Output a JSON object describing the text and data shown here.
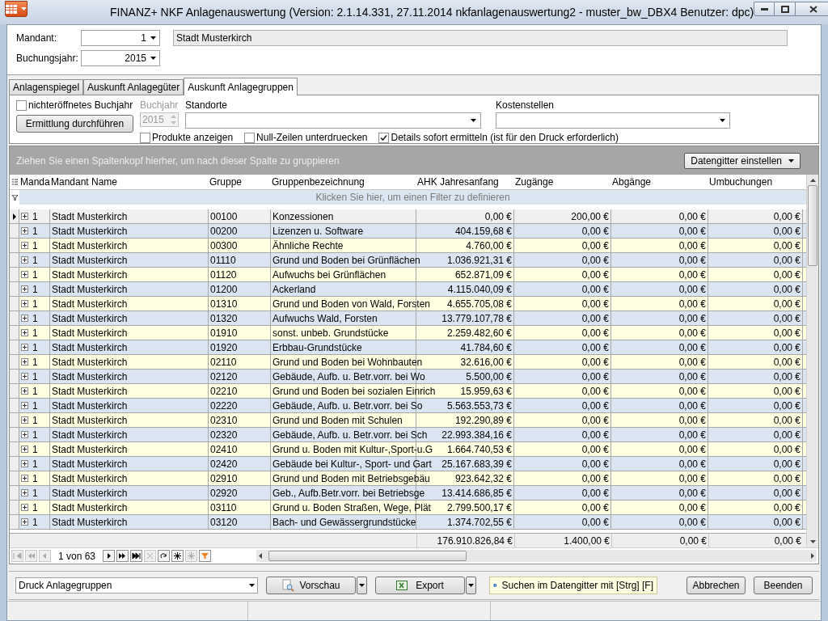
{
  "window": {
    "title": "FINANZ+ NKF Anlagenauswertung (Version: 2.1.14.331, 27.11.2014 nkfanlagenauswertung2 - muster_bw_DBX4 Benutzer: dpc)"
  },
  "header": {
    "mandant": {
      "label": "Mandant:",
      "value": "1",
      "name": "Stadt Musterkirch"
    },
    "buchungsjahr": {
      "label": "Buchungsjahr:",
      "value": "2015"
    }
  },
  "tabs": [
    {
      "label": "Anlagenspiegel",
      "selected": false
    },
    {
      "label": "Auskunft Anlagegüter",
      "selected": false
    },
    {
      "label": "Auskunft Anlagegruppen",
      "selected": true
    }
  ],
  "filter": {
    "unopened_year": {
      "label": "nichteröffnetes Buchjahr",
      "checked": false
    },
    "run_button": "Ermittlung durchführen",
    "buchjahr": {
      "label": "Buchjahr",
      "value": "2015",
      "disabled": true
    },
    "standorte": {
      "label": "Standorte"
    },
    "kostenstellen": {
      "label": "Kostenstellen"
    },
    "options": [
      {
        "label": "Produkte anzeigen",
        "checked": false
      },
      {
        "label": "Null-Zeilen unterdruecken",
        "checked": false
      },
      {
        "label": "Details sofort ermitteln (ist für den Druck erforderlich)",
        "checked": true
      }
    ]
  },
  "grid": {
    "group_hint": "Ziehen Sie einen Spaltenkopf hierher, um nach dieser Spalte zu gruppieren",
    "settings_button": "Datengitter einstellen",
    "filter_hint": "Klicken Sie hier, um einen Filter zu definieren",
    "columns": [
      "Manda",
      "Mandant Name",
      "Gruppe",
      "Gruppenbezeichnung",
      "AHK Jahresanfang",
      "Zugänge",
      "Abgänge",
      "Umbuchungen"
    ],
    "rows": [
      {
        "selected": true,
        "expanded": false,
        "cells": [
          "1",
          "Stadt Musterkirch",
          "00100",
          "Konzessionen",
          "0,00 €",
          "200,00 €",
          "0,00 €",
          "0,00 €"
        ]
      },
      {
        "selected": false,
        "expanded": false,
        "cells": [
          "1",
          "Stadt Musterkirch",
          "00200",
          "Lizenzen u. Software",
          "404.159,68 €",
          "0,00 €",
          "0,00 €",
          "0,00 €"
        ]
      },
      {
        "selected": false,
        "expanded": false,
        "cells": [
          "1",
          "Stadt Musterkirch",
          "00300",
          "Ähnliche Rechte",
          "4.760,00 €",
          "0,00 €",
          "0,00 €",
          "0,00 €"
        ]
      },
      {
        "selected": false,
        "expanded": false,
        "cells": [
          "1",
          "Stadt Musterkirch",
          "01110",
          "Grund und Boden bei Grünflächen",
          "1.036.921,31 €",
          "0,00 €",
          "0,00 €",
          "0,00 €"
        ]
      },
      {
        "selected": false,
        "expanded": false,
        "cells": [
          "1",
          "Stadt Musterkirch",
          "01120",
          "Aufwuchs bei Grünflächen",
          "652.871,09 €",
          "0,00 €",
          "0,00 €",
          "0,00 €"
        ]
      },
      {
        "selected": false,
        "expanded": false,
        "cells": [
          "1",
          "Stadt Musterkirch",
          "01200",
          "Ackerland",
          "4.115.040,09 €",
          "0,00 €",
          "0,00 €",
          "0,00 €"
        ]
      },
      {
        "selected": false,
        "expanded": false,
        "cells": [
          "1",
          "Stadt Musterkirch",
          "01310",
          "Grund und Boden von Wald, Forsten",
          "4.655.705,08 €",
          "0,00 €",
          "0,00 €",
          "0,00 €"
        ]
      },
      {
        "selected": false,
        "expanded": false,
        "cells": [
          "1",
          "Stadt Musterkirch",
          "01320",
          "Aufwuchs Wald, Forsten",
          "13.779.107,78 €",
          "0,00 €",
          "0,00 €",
          "0,00 €"
        ]
      },
      {
        "selected": false,
        "expanded": false,
        "cells": [
          "1",
          "Stadt Musterkirch",
          "01910",
          "sonst. unbeb. Grundstücke",
          "2.259.482,60 €",
          "0,00 €",
          "0,00 €",
          "0,00 €"
        ]
      },
      {
        "selected": false,
        "expanded": false,
        "cells": [
          "1",
          "Stadt Musterkirch",
          "01920",
          "Erbbau-Grundstücke",
          "41.784,60 €",
          "0,00 €",
          "0,00 €",
          "0,00 €"
        ]
      },
      {
        "selected": false,
        "expanded": false,
        "cells": [
          "1",
          "Stadt Musterkirch",
          "02110",
          "Grund und Boden bei Wohnbauten",
          "32.616,00 €",
          "0,00 €",
          "0,00 €",
          "0,00 €"
        ]
      },
      {
        "selected": false,
        "expanded": false,
        "cells": [
          "1",
          "Stadt Musterkirch",
          "02120",
          "Gebäude, Aufb. u. Betr.vorr. bei Wo",
          "5.500,00 €",
          "0,00 €",
          "0,00 €",
          "0,00 €"
        ]
      },
      {
        "selected": false,
        "expanded": false,
        "cells": [
          "1",
          "Stadt Musterkirch",
          "02210",
          "Grund und Boden bei sozialen Einrich",
          "15.959,63 €",
          "0,00 €",
          "0,00 €",
          "0,00 €"
        ]
      },
      {
        "selected": false,
        "expanded": false,
        "cells": [
          "1",
          "Stadt Musterkirch",
          "02220",
          "Gebäude, Aufb. u. Betr.vorr. bei So",
          "5.563.553,73 €",
          "0,00 €",
          "0,00 €",
          "0,00 €"
        ]
      },
      {
        "selected": false,
        "expanded": false,
        "cells": [
          "1",
          "Stadt Musterkirch",
          "02310",
          "Grund und Boden mit Schulen",
          "192.290,89 €",
          "0,00 €",
          "0,00 €",
          "0,00 €"
        ]
      },
      {
        "selected": false,
        "expanded": false,
        "cells": [
          "1",
          "Stadt Musterkirch",
          "02320",
          "Gebäude, Aufb. u. Betr.vorr. bei Sch",
          "22.993.384,16 €",
          "0,00 €",
          "0,00 €",
          "0,00 €"
        ]
      },
      {
        "selected": false,
        "expanded": false,
        "cells": [
          "1",
          "Stadt Musterkirch",
          "02410",
          "Grund u. Boden mit Kultur-,Sport-u.G",
          "1.664.740,53 €",
          "0,00 €",
          "0,00 €",
          "0,00 €"
        ]
      },
      {
        "selected": false,
        "expanded": false,
        "cells": [
          "1",
          "Stadt Musterkirch",
          "02420",
          "Gebäude bei Kultur-, Sport- und Gart",
          "25.167.683,39 €",
          "0,00 €",
          "0,00 €",
          "0,00 €"
        ]
      },
      {
        "selected": false,
        "expanded": false,
        "cells": [
          "1",
          "Stadt Musterkirch",
          "02910",
          "Grund und Boden mit Betriebsgebäu",
          "923.642,32 €",
          "0,00 €",
          "0,00 €",
          "0,00 €"
        ]
      },
      {
        "selected": false,
        "expanded": false,
        "cells": [
          "1",
          "Stadt Musterkirch",
          "02920",
          "Geb., Aufb.Betr.vorr. bei Betriebsge",
          "13.414.686,85 €",
          "0,00 €",
          "0,00 €",
          "0,00 €"
        ]
      },
      {
        "selected": false,
        "expanded": false,
        "cells": [
          "1",
          "Stadt Musterkirch",
          "03110",
          "Grund u. Boden Straßen, Wege, Plät",
          "2.799.500,17 €",
          "0,00 €",
          "0,00 €",
          "0,00 €"
        ]
      },
      {
        "selected": false,
        "expanded": false,
        "cells": [
          "1",
          "Stadt Musterkirch",
          "03120",
          "Bach- und Gewässergrundstücke",
          "1.374.702,55 €",
          "0,00 €",
          "0,00 €",
          "0,00 €"
        ]
      }
    ],
    "totals": [
      "176.910.826,84 €",
      "1.400,00 €",
      "0,00 €",
      "0,00 €"
    ],
    "page_text": "1 von 63"
  },
  "bottom": {
    "report": "Druck Anlagegruppen",
    "preview_button": "Vorschau",
    "export_button": "Export",
    "hint": "Suchen im Datengitter mit [Strg] [F]",
    "cancel_button": "Abbrechen",
    "close_button": "Beenden"
  }
}
